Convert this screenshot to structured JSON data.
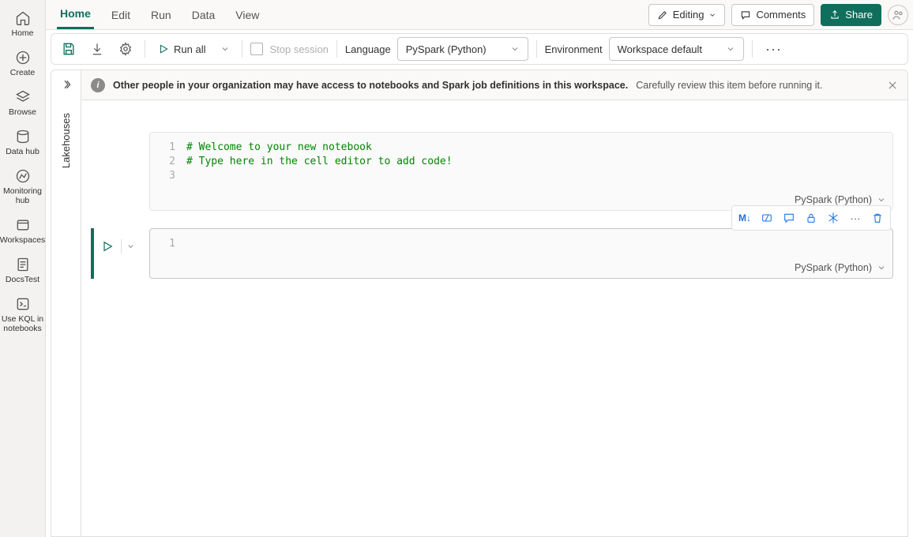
{
  "nav": {
    "items": [
      {
        "label": "Home",
        "icon": "home"
      },
      {
        "label": "Create",
        "icon": "plus-circle"
      },
      {
        "label": "Browse",
        "icon": "layers"
      },
      {
        "label": "Data hub",
        "icon": "data"
      },
      {
        "label": "Monitoring hub",
        "icon": "monitor"
      },
      {
        "label": "Workspaces",
        "icon": "workspaces"
      },
      {
        "label": "DocsTest",
        "icon": "doc"
      },
      {
        "label": "Use KQL in notebooks",
        "icon": "kql"
      }
    ]
  },
  "tabs": {
    "items": [
      {
        "label": "Home",
        "active": true
      },
      {
        "label": "Edit"
      },
      {
        "label": "Run"
      },
      {
        "label": "Data"
      },
      {
        "label": "View"
      }
    ],
    "editing": "Editing",
    "comments": "Comments",
    "share": "Share"
  },
  "toolbar": {
    "runall": "Run all",
    "stop": "Stop session",
    "language_label": "Language",
    "language_value": "PySpark (Python)",
    "environment_label": "Environment",
    "environment_value": "Workspace default"
  },
  "sidepanel": {
    "label": "Lakehouses"
  },
  "banner": {
    "bold": "Other people in your organization may have access to notebooks and Spark job definitions in this workspace.",
    "rest": "Carefully review this item before running it."
  },
  "cells": [
    {
      "lines": [
        {
          "n": "1",
          "text": "# Welcome to your new notebook"
        },
        {
          "n": "2",
          "text": "# Type here in the cell editor to add code!"
        },
        {
          "n": "3",
          "text": ""
        }
      ],
      "footer_lang": "PySpark (Python)",
      "active": false
    },
    {
      "lines": [
        {
          "n": "1",
          "text": ""
        }
      ],
      "footer_lang": "PySpark (Python)",
      "active": true
    }
  ],
  "cell_toolbar_icons": [
    "M↓",
    "toggle",
    "comment",
    "lock",
    "snowflake",
    "more",
    "trash"
  ]
}
